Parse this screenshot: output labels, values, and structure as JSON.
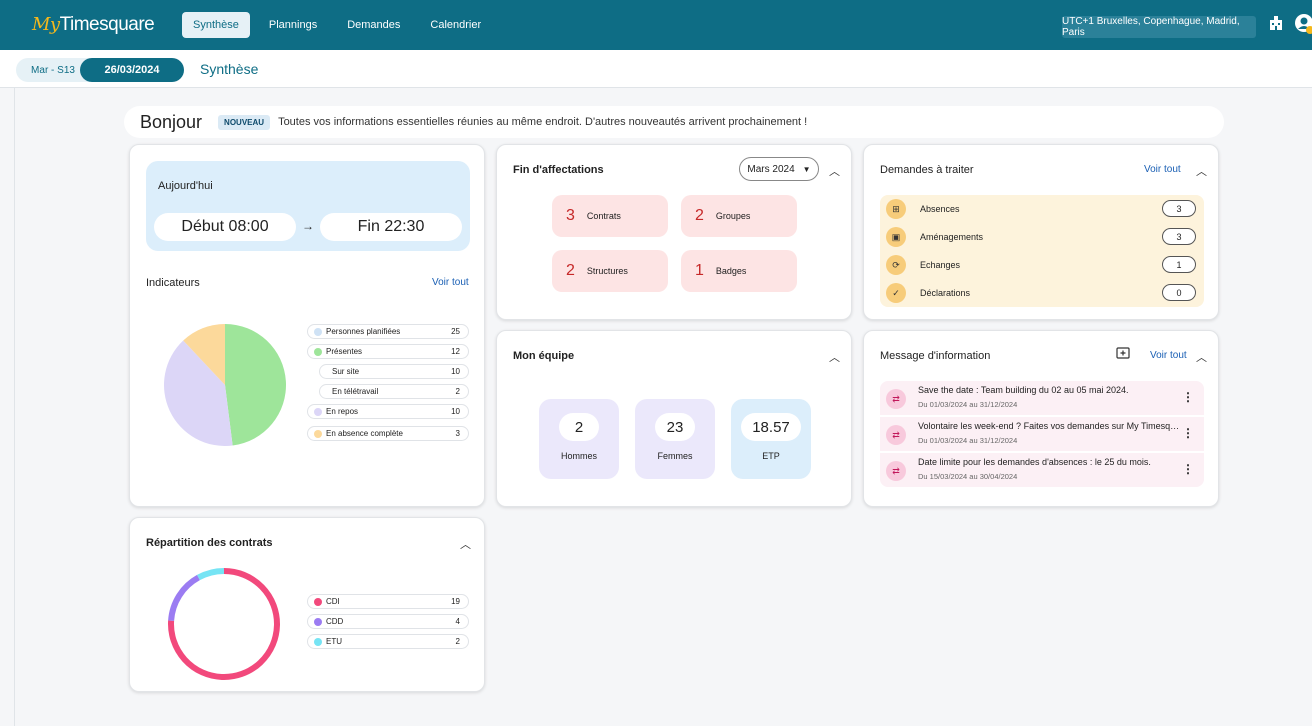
{
  "app": {
    "logo_prefix": "My",
    "logo_name": "Timesquare"
  },
  "nav": [
    {
      "label": "Synthèse",
      "active": true
    },
    {
      "label": "Plannings"
    },
    {
      "label": "Demandes"
    },
    {
      "label": "Calendrier"
    }
  ],
  "timezone": "UTC+1 Bruxelles, Copenhague, Madrid, Paris",
  "icons": {
    "building": "building-icon",
    "user": "user-icon"
  },
  "subbar": {
    "week": "Mar - S13",
    "date": "26/03/2024",
    "breadcrumb": "Synthèse"
  },
  "hello": {
    "title": "Bonjour",
    "badge": "NOUVEAU",
    "text": "Toutes vos informations essentielles réunies au même endroit. D'autres nouveautés arrivent prochainement !"
  },
  "today": {
    "title": "Aujourd'hui",
    "start": "Début 08:00",
    "arrow": "→",
    "end": "Fin 22:30"
  },
  "indicators": {
    "title": "Indicateurs",
    "link": "Voir tout",
    "items": [
      {
        "label": "Personnes planifiées",
        "value": "25",
        "color": "#cfe2f5"
      },
      {
        "label": "Présentes",
        "value": "12",
        "color": "#9ee59a"
      },
      {
        "label": "Sur site",
        "value": "10"
      },
      {
        "label": "En télétravail",
        "value": "2"
      },
      {
        "label": "En repos",
        "value": "10",
        "color": "#dcd6f7"
      },
      {
        "label": "En absence complète",
        "value": "3",
        "color": "#fcd99b"
      }
    ]
  },
  "chart_data": [
    {
      "type": "pie",
      "slices": [
        {
          "name": "Présentes",
          "value": 12,
          "color": "#9ee59a"
        },
        {
          "name": "En repos",
          "value": 10,
          "color": "#dcd6f7"
        },
        {
          "name": "En absence complète",
          "value": 3,
          "color": "#fcd99b"
        }
      ]
    },
    {
      "type": "pie",
      "donut": true,
      "slices": [
        {
          "name": "CDI",
          "value": 19,
          "color": "#f2497c"
        },
        {
          "name": "CDD",
          "value": 4,
          "color": "#9b7cf2"
        },
        {
          "name": "ETU",
          "value": 2,
          "color": "#76e4f4"
        }
      ]
    }
  ],
  "contracts": {
    "title": "Répartition des contrats",
    "items": [
      {
        "label": "CDI",
        "value": "19",
        "color": "#f2497c"
      },
      {
        "label": "CDD",
        "value": "4",
        "color": "#9b7cf2"
      },
      {
        "label": "ETU",
        "value": "2",
        "color": "#76e4f4"
      }
    ]
  },
  "affectations": {
    "title": "Fin d'affectations",
    "month": "Mars 2024",
    "tiles": [
      {
        "num": "3",
        "label": "Contrats"
      },
      {
        "num": "2",
        "label": "Groupes"
      },
      {
        "num": "2",
        "label": "Structures"
      },
      {
        "num": "1",
        "label": "Badges"
      }
    ]
  },
  "team": {
    "title": "Mon équipe",
    "items": [
      {
        "num": "2",
        "label": "Hommes",
        "color": "#ebe8fb"
      },
      {
        "num": "23",
        "label": "Femmes",
        "color": "#ebe8fb"
      },
      {
        "num": "18.57",
        "label": "ETP",
        "color": "#dceefb"
      }
    ]
  },
  "requests": {
    "title": "Demandes à traiter",
    "link": "Voir tout",
    "items": [
      {
        "label": "Absences",
        "count": "3",
        "icon": "⊞"
      },
      {
        "label": "Aménagements",
        "count": "3",
        "icon": "▣"
      },
      {
        "label": "Echanges",
        "count": "1",
        "icon": "⟳"
      },
      {
        "label": "Déclarations",
        "count": "0",
        "icon": "✓"
      }
    ]
  },
  "messages": {
    "title": "Message d'information",
    "link": "Voir tout",
    "items": [
      {
        "title": "Save the date : Team building du 02 au 05 mai 2024.",
        "date": "Du 01/03/2024 au 31/12/2024"
      },
      {
        "title": "Volontaire les week-end ? Faites vos demandes sur My Timesquare",
        "date": "Du 01/03/2024 au 31/12/2024"
      },
      {
        "title": "Date limite pour les demandes d'absences : le 25 du mois.",
        "date": "Du 15/03/2024 au 30/04/2024"
      }
    ]
  }
}
